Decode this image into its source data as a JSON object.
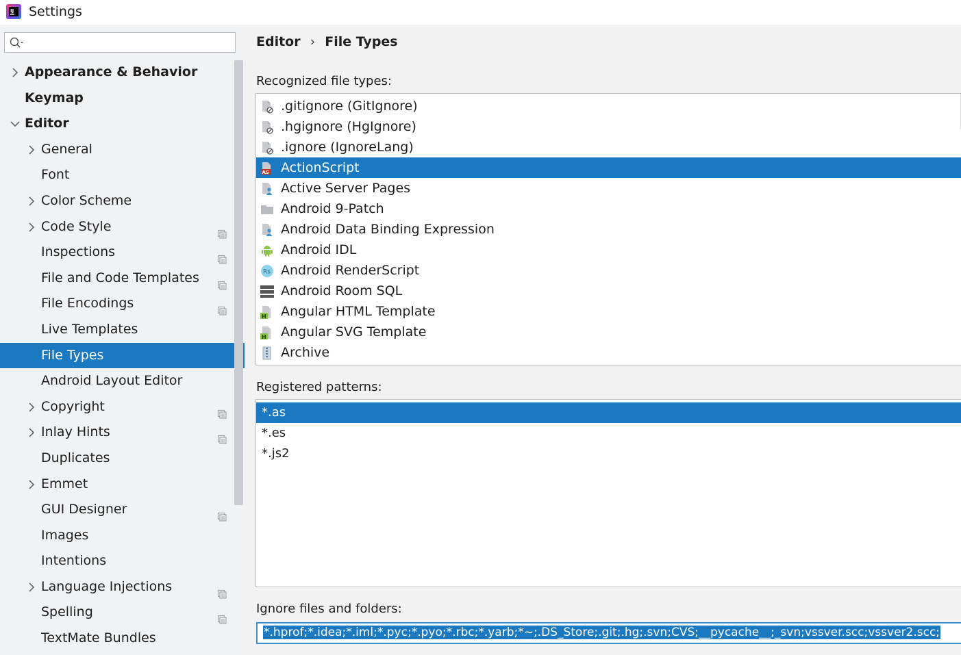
{
  "window": {
    "title": "Settings",
    "icon": "intellij-logo-icon"
  },
  "search": {
    "placeholder": "",
    "value": ""
  },
  "sidebar": {
    "items": [
      {
        "label": "Appearance & Behavior",
        "level": 0,
        "arrow": "right",
        "bold": true,
        "project_icon": false,
        "selected": false
      },
      {
        "label": "Keymap",
        "level": 0,
        "arrow": "none",
        "bold": true,
        "project_icon": false,
        "selected": false
      },
      {
        "label": "Editor",
        "level": 0,
        "arrow": "down",
        "bold": true,
        "project_icon": false,
        "selected": false
      },
      {
        "label": "General",
        "level": 1,
        "arrow": "right",
        "bold": false,
        "project_icon": false,
        "selected": false
      },
      {
        "label": "Font",
        "level": 1,
        "arrow": "none",
        "bold": false,
        "project_icon": false,
        "selected": false
      },
      {
        "label": "Color Scheme",
        "level": 1,
        "arrow": "right",
        "bold": false,
        "project_icon": false,
        "selected": false
      },
      {
        "label": "Code Style",
        "level": 1,
        "arrow": "right",
        "bold": false,
        "project_icon": true,
        "selected": false
      },
      {
        "label": "Inspections",
        "level": 1,
        "arrow": "none",
        "bold": false,
        "project_icon": true,
        "selected": false
      },
      {
        "label": "File and Code Templates",
        "level": 1,
        "arrow": "none",
        "bold": false,
        "project_icon": true,
        "selected": false
      },
      {
        "label": "File Encodings",
        "level": 1,
        "arrow": "none",
        "bold": false,
        "project_icon": true,
        "selected": false
      },
      {
        "label": "Live Templates",
        "level": 1,
        "arrow": "none",
        "bold": false,
        "project_icon": false,
        "selected": false
      },
      {
        "label": "File Types",
        "level": 1,
        "arrow": "none",
        "bold": false,
        "project_icon": false,
        "selected": true
      },
      {
        "label": "Android Layout Editor",
        "level": 1,
        "arrow": "none",
        "bold": false,
        "project_icon": false,
        "selected": false
      },
      {
        "label": "Copyright",
        "level": 1,
        "arrow": "right",
        "bold": false,
        "project_icon": true,
        "selected": false
      },
      {
        "label": "Inlay Hints",
        "level": 1,
        "arrow": "right",
        "bold": false,
        "project_icon": true,
        "selected": false
      },
      {
        "label": "Duplicates",
        "level": 1,
        "arrow": "none",
        "bold": false,
        "project_icon": false,
        "selected": false
      },
      {
        "label": "Emmet",
        "level": 1,
        "arrow": "right",
        "bold": false,
        "project_icon": false,
        "selected": false
      },
      {
        "label": "GUI Designer",
        "level": 1,
        "arrow": "none",
        "bold": false,
        "project_icon": true,
        "selected": false
      },
      {
        "label": "Images",
        "level": 1,
        "arrow": "none",
        "bold": false,
        "project_icon": false,
        "selected": false
      },
      {
        "label": "Intentions",
        "level": 1,
        "arrow": "none",
        "bold": false,
        "project_icon": false,
        "selected": false
      },
      {
        "label": "Language Injections",
        "level": 1,
        "arrow": "right",
        "bold": false,
        "project_icon": true,
        "selected": false
      },
      {
        "label": "Spelling",
        "level": 1,
        "arrow": "none",
        "bold": false,
        "project_icon": true,
        "selected": false
      },
      {
        "label": "TextMate Bundles",
        "level": 1,
        "arrow": "none",
        "bold": false,
        "project_icon": false,
        "selected": false
      }
    ]
  },
  "breadcrumb": {
    "parent": "Editor",
    "separator": "›",
    "current": "File Types"
  },
  "recognized": {
    "label": "Recognized file types:",
    "items": [
      {
        "label": ".gitignore (GitIgnore)",
        "icon": "ignore-file-icon",
        "selected": false
      },
      {
        "label": ".hgignore (HgIgnore)",
        "icon": "ignore-file-icon",
        "selected": false
      },
      {
        "label": ".ignore (IgnoreLang)",
        "icon": "ignore-file-icon",
        "selected": false
      },
      {
        "label": "ActionScript",
        "icon": "actionscript-file-icon",
        "selected": true
      },
      {
        "label": "Active Server Pages",
        "icon": "asp-file-icon",
        "selected": false
      },
      {
        "label": "Android 9-Patch",
        "icon": "folder-icon",
        "selected": false
      },
      {
        "label": "Android Data Binding Expression",
        "icon": "asp-file-icon",
        "selected": false
      },
      {
        "label": "Android IDL",
        "icon": "android-icon",
        "selected": false
      },
      {
        "label": "Android RenderScript",
        "icon": "renderscript-icon",
        "selected": false
      },
      {
        "label": "Android Room SQL",
        "icon": "database-icon",
        "selected": false
      },
      {
        "label": "Angular HTML Template",
        "icon": "html-file-icon",
        "selected": false
      },
      {
        "label": "Angular SVG Template",
        "icon": "html-file-icon",
        "selected": false
      },
      {
        "label": "Archive",
        "icon": "archive-icon",
        "selected": false
      }
    ]
  },
  "patterns": {
    "label": "Registered patterns:",
    "items": [
      {
        "label": "*.as",
        "selected": true
      },
      {
        "label": "*.es",
        "selected": false
      },
      {
        "label": "*.js2",
        "selected": false
      }
    ]
  },
  "ignore": {
    "label": "Ignore files and folders:",
    "value": "*.hprof;*.idea;*.iml;*.pyc;*.pyo;*.rbc;*.yarb;*~;.DS_Store;.git;.hg;.svn;CVS;__pycache__;_svn;vssver.scc;vssver2.scc;"
  },
  "colors": {
    "selection": "#1b79c2",
    "sidebar_bg": "#f0f2f4",
    "main_bg": "#f2f2f2"
  }
}
